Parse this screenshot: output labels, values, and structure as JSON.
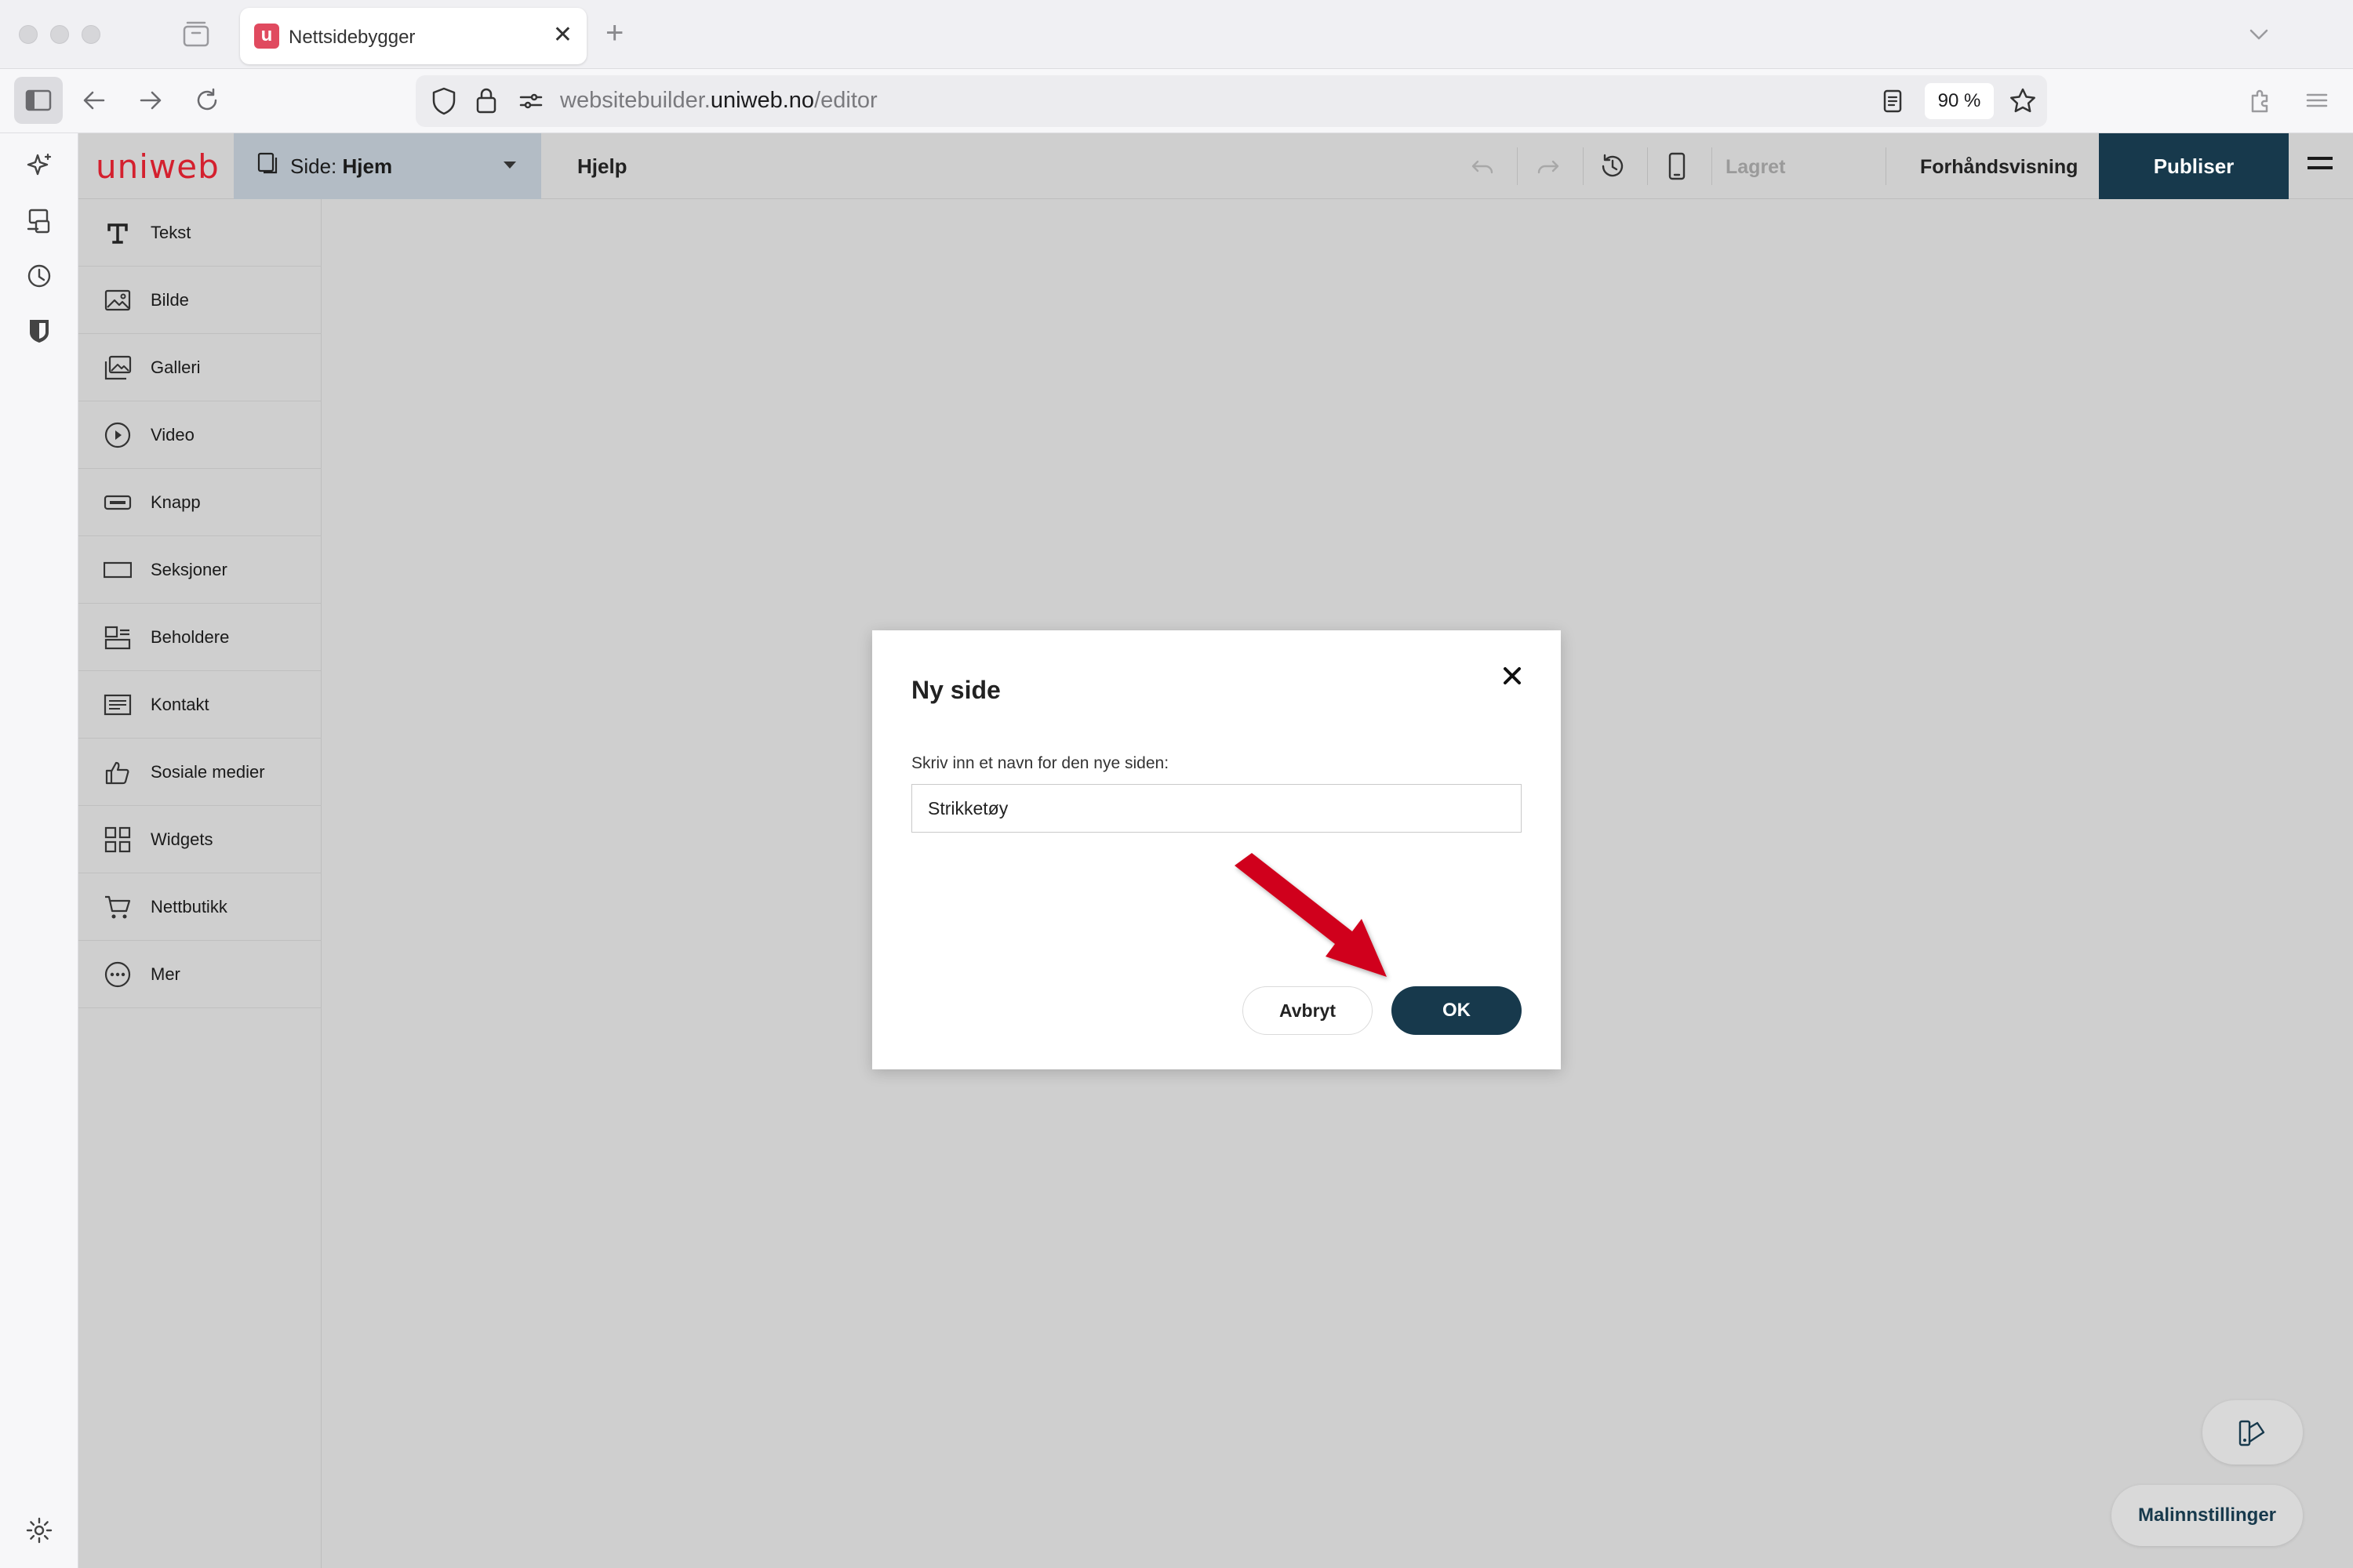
{
  "browser": {
    "tab_title": "Nettsidebygger",
    "favicon_letter": "u",
    "url_prefix": "websitebuilder.",
    "url_host": "uniweb.no",
    "url_path": "/editor",
    "zoom": "90 %"
  },
  "app": {
    "logo": "uniweb",
    "page_selector": {
      "prefix": "Side: ",
      "value": "Hjem"
    },
    "help_label": "Hjelp",
    "saved_label": "Lagret",
    "preview_label": "Forhåndsvisning",
    "publish_label": "Publiser",
    "colors": {
      "accent": "#17394c",
      "brand": "#d4202e",
      "annotation_arrow": "#d0021b"
    }
  },
  "elements": [
    {
      "label": "Tekst",
      "icon": "text-icon"
    },
    {
      "label": "Bilde",
      "icon": "image-icon"
    },
    {
      "label": "Galleri",
      "icon": "gallery-icon"
    },
    {
      "label": "Video",
      "icon": "video-icon"
    },
    {
      "label": "Knapp",
      "icon": "button-icon"
    },
    {
      "label": "Seksjoner",
      "icon": "section-icon"
    },
    {
      "label": "Beholdere",
      "icon": "container-icon"
    },
    {
      "label": "Kontakt",
      "icon": "contact-form-icon"
    },
    {
      "label": "Sosiale medier",
      "icon": "thumbs-up-icon"
    },
    {
      "label": "Widgets",
      "icon": "widgets-icon"
    },
    {
      "label": "Nettbutikk",
      "icon": "cart-icon"
    },
    {
      "label": "Mer",
      "icon": "more-icon"
    }
  ],
  "template_settings_label": "Malinnstillinger",
  "modal": {
    "title": "Ny side",
    "label": "Skriv inn et navn for den nye siden:",
    "input_value": "Strikketøy",
    "cancel_label": "Avbryt",
    "ok_label": "OK"
  }
}
